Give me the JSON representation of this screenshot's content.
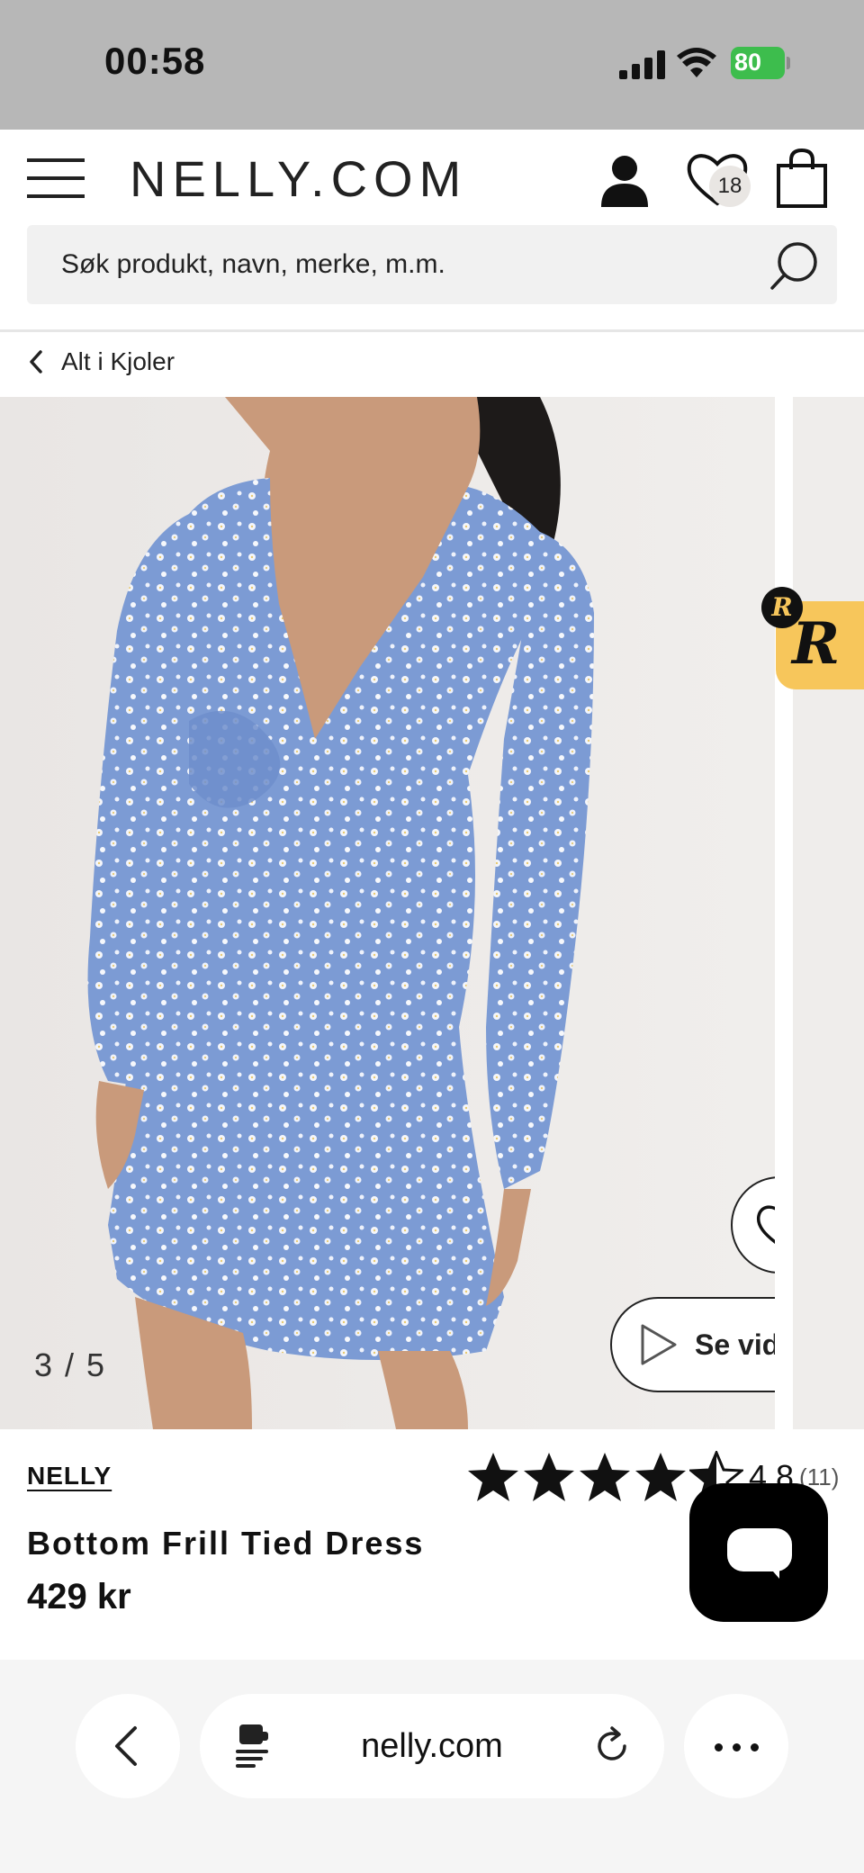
{
  "status_bar": {
    "time": "00:58",
    "battery": "80"
  },
  "header": {
    "logo": "NELLY.COM",
    "wishlist_count": "18",
    "search_placeholder": "Søk produkt, navn, merke, m.m."
  },
  "breadcrumb": {
    "label": "Alt i Kjoler"
  },
  "gallery": {
    "counter": "3 / 5",
    "video_label": "Se video",
    "badge_letter": "R"
  },
  "product": {
    "brand": "NELLY",
    "title": "Bottom Frill Tied Dress",
    "price": "429 kr",
    "rating_value": "4.8",
    "rating_count": "(11)",
    "rating_stars": 4.5
  },
  "browser": {
    "url": "nelly.com"
  },
  "colors": {
    "accent": "#111111",
    "battery": "#3dbd4d",
    "badge": "#f7c65b",
    "dress": "#7c9bd4"
  }
}
